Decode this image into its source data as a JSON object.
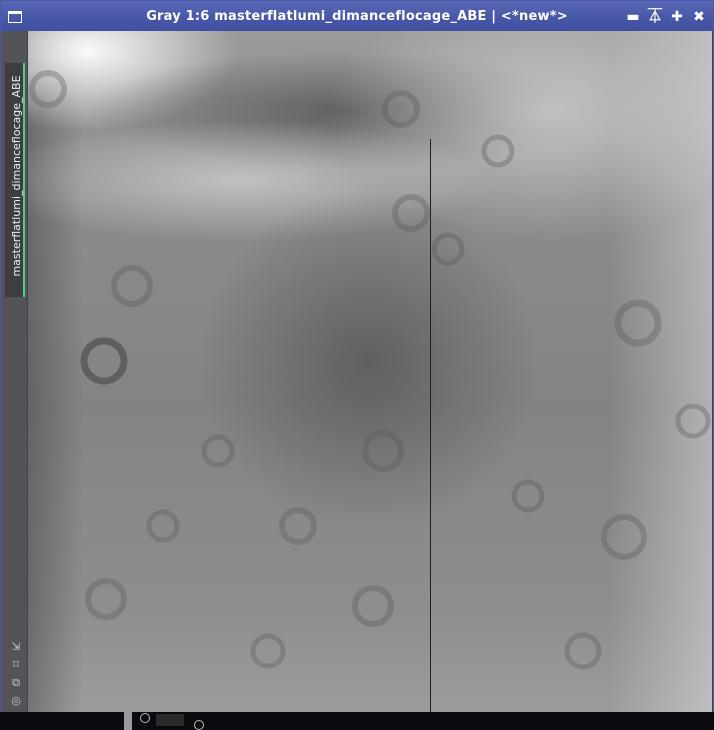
{
  "window": {
    "title": "Gray 1:6 masterflatlumi_dimanceflocage_ABE | <*new*>",
    "controls": [
      {
        "name": "minimize",
        "glyph": "▬"
      },
      {
        "name": "shade",
        "glyph": "⏄"
      },
      {
        "name": "maximize",
        "glyph": "✚"
      },
      {
        "name": "close",
        "glyph": "✖"
      }
    ]
  },
  "view_tab": {
    "label": "masterflatlumi_dimanceflocage_ABE",
    "accent_color": "#4fd080"
  },
  "tools": [
    {
      "icon": "fit-view-icon",
      "glyph": "⇲"
    },
    {
      "icon": "zoom-to-fit-icon",
      "glyph": "⌑"
    },
    {
      "icon": "clone-icon",
      "glyph": "⧉"
    },
    {
      "icon": "target-icon",
      "glyph": "◎"
    }
  ],
  "colors": {
    "titlebar": "#4756a6",
    "image_gray": "#8a8a8a"
  }
}
